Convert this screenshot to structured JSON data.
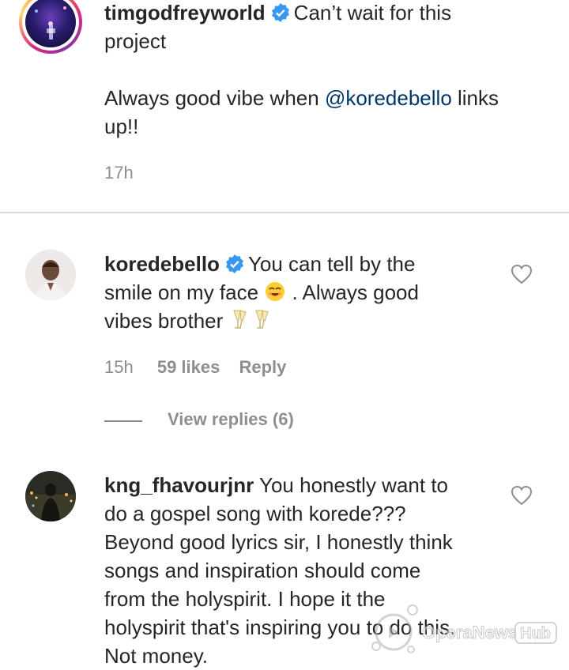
{
  "comments": [
    {
      "username": "timgodfreyworld",
      "text_part1": "Can’t wait for this",
      "text_part2": "project",
      "text_part3": "Always good vibe when ",
      "mention": "@koredebello",
      "text_part4": " links",
      "text_part5": "up!!",
      "time": "17h",
      "avatar_icon": "profile-photo"
    },
    {
      "username": "koredebello",
      "text_part1": "You can tell by the",
      "text_part2": "smile on my face",
      "text_part3": ". Always good",
      "text_part4": "vibes brother",
      "time": "15h",
      "likes": "59 likes",
      "reply": "Reply",
      "view_replies": "View replies (6)",
      "avatar_icon": "profile-photo"
    },
    {
      "username": "kng_fhavourjnr",
      "line1": "You honestly want to",
      "line2": "do a gospel song with korede???",
      "line3": "Beyond good lyrics sir, I honestly think",
      "line4": "songs and inspiration should come",
      "line5": "from the holyspirit. I hope it the",
      "line6": "holyspirit that's inspiring you to do this.",
      "line7": "Not money.",
      "avatar_icon": "profile-photo"
    }
  ],
  "watermark": {
    "brand": "OperaNews",
    "badge": "Hub"
  },
  "colors": {
    "text": "#262626",
    "muted": "#8e8e8e",
    "mention": "#00376b",
    "verified": "#3897f0",
    "divider": "#dbdbdb"
  }
}
